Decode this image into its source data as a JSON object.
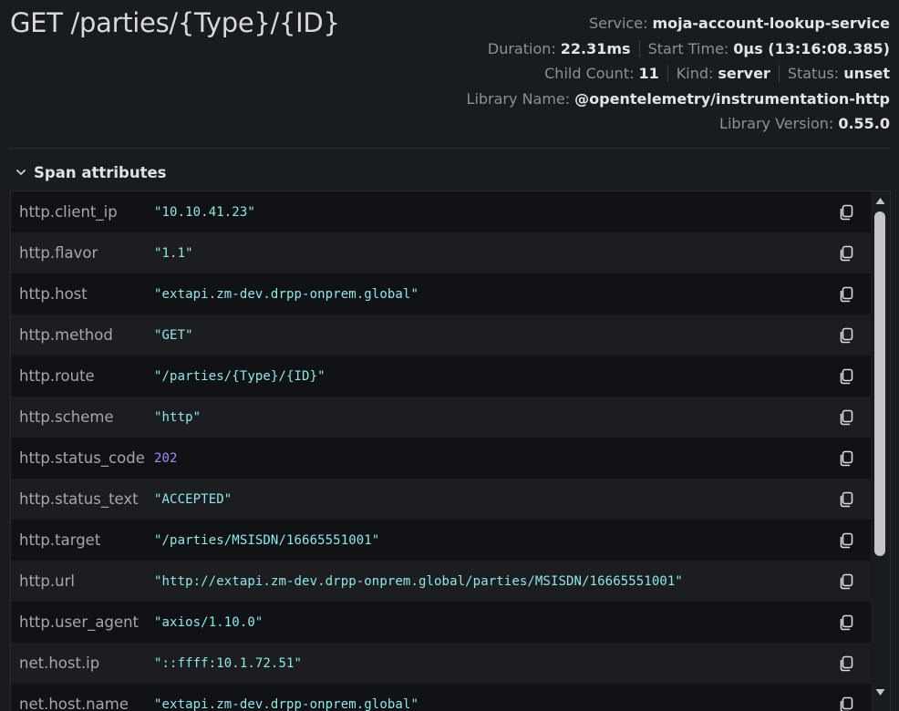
{
  "span": {
    "title": "GET /parties/{Type}/{ID}",
    "service_label": "Service:",
    "service_value": "moja-account-lookup-service",
    "duration_label": "Duration:",
    "duration_value": "22.31ms",
    "start_label": "Start Time:",
    "start_value": "0μs (13:16:08.385)",
    "child_count_label": "Child Count:",
    "child_count_value": "11",
    "kind_label": "Kind:",
    "kind_value": "server",
    "status_label": "Status:",
    "status_value": "unset",
    "library_name_label": "Library Name:",
    "library_name_value": "@opentelemetry/instrumentation-http",
    "library_version_label": "Library Version:",
    "library_version_value": "0.55.0"
  },
  "section": {
    "title": "Span attributes"
  },
  "attributes": [
    {
      "key": "http.client_ip",
      "value": "\"10.10.41.23\""
    },
    {
      "key": "http.flavor",
      "value": "\"1.1\""
    },
    {
      "key": "http.host",
      "value": "\"extapi.zm-dev.drpp-onprem.global\""
    },
    {
      "key": "http.method",
      "value": "\"GET\""
    },
    {
      "key": "http.route",
      "value": "\"/parties/{Type}/{ID}\""
    },
    {
      "key": "http.scheme",
      "value": "\"http\""
    },
    {
      "key": "http.status_code",
      "value": "202"
    },
    {
      "key": "http.status_text",
      "value": "\"ACCEPTED\""
    },
    {
      "key": "http.target",
      "value": "\"/parties/MSISDN/16665551001\""
    },
    {
      "key": "http.url",
      "value": "\"http://extapi.zm-dev.drpp-onprem.global/parties/MSISDN/16665551001\""
    },
    {
      "key": "http.user_agent",
      "value": "\"axios/1.10.0\""
    },
    {
      "key": "net.host.ip",
      "value": "\"::ffff:10.1.72.51\""
    },
    {
      "key": "net.host.name",
      "value": "\"extapi.zm-dev.drpp-onprem.global\""
    }
  ],
  "icons": {
    "copy": "copy-icon",
    "chevron": "chevron-down-icon"
  },
  "colors": {
    "background": "#181b1f",
    "string_value": "#8ee8e8",
    "number_value": "#9d8dfa"
  }
}
